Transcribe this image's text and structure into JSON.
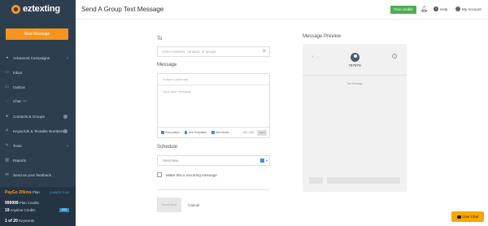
{
  "sidebar": {
    "logo_text": "eztexting",
    "new_message_label": "New Message",
    "items": [
      {
        "label": "Advanced Campaigns",
        "icon": "megaphone-icon",
        "chevron": true
      },
      {
        "label": "Inbox",
        "icon": "inbox-icon"
      },
      {
        "label": "Outbox",
        "icon": "outbox-icon"
      },
      {
        "label": "Chat ™️",
        "icon": "chat-icon"
      },
      {
        "label": "Contacts & Groups",
        "icon": "contacts-icon",
        "dot": true
      },
      {
        "label": "Keywords & Textable Numbers",
        "icon": "keyword-icon",
        "dot": true
      },
      {
        "label": "Tools",
        "icon": "tools-icon",
        "chevron": true
      },
      {
        "label": "Reports",
        "icon": "reports-icon"
      },
      {
        "label": "Send us your feedback",
        "icon": "feedback-icon"
      }
    ],
    "plan": {
      "name": "PayGo 20kms",
      "suffix": "Plan",
      "upgrade_label": "CHANGE PLAN",
      "plan_credits_value": "999999",
      "plan_credits_label": "Plan Credits",
      "anytime_credits_value": "19",
      "anytime_credits_label": "Anytime Credits",
      "add_label": "ADD",
      "keywords_value": "1 of 20",
      "keywords_label": "Keywords"
    }
  },
  "header": {
    "title": "Send A Group Text Message",
    "free_credits_label": "Free credits",
    "help_label": "Help",
    "account_label": "My Account"
  },
  "form": {
    "to_label": "To",
    "to_placeholder": "Enter numbers, contacts, or groups",
    "message_label": "Message",
    "subject_placeholder": "Subject (optional)",
    "body_placeholder": "Type your message",
    "toolbar": {
      "personalize": "Personalize",
      "templates": "Use Templates",
      "media": "Add Media",
      "count": "160 / 160",
      "short_btn": "Send"
    },
    "schedule_label": "Schedule",
    "schedule_value": "Send Now",
    "recurring_label": "Make this a recurring message",
    "send_button": "Send Now",
    "cancel_button": "Cancel"
  },
  "preview": {
    "title": "Message Preview",
    "number": "797979",
    "text_message_label": "Text Message"
  },
  "live_chat_label": "Live Chat",
  "colors": {
    "sidebar_bg": "#2d3e4f",
    "accent": "#f7941d",
    "free_credits": "#4caf50",
    "live_chat": "#f7a800"
  }
}
